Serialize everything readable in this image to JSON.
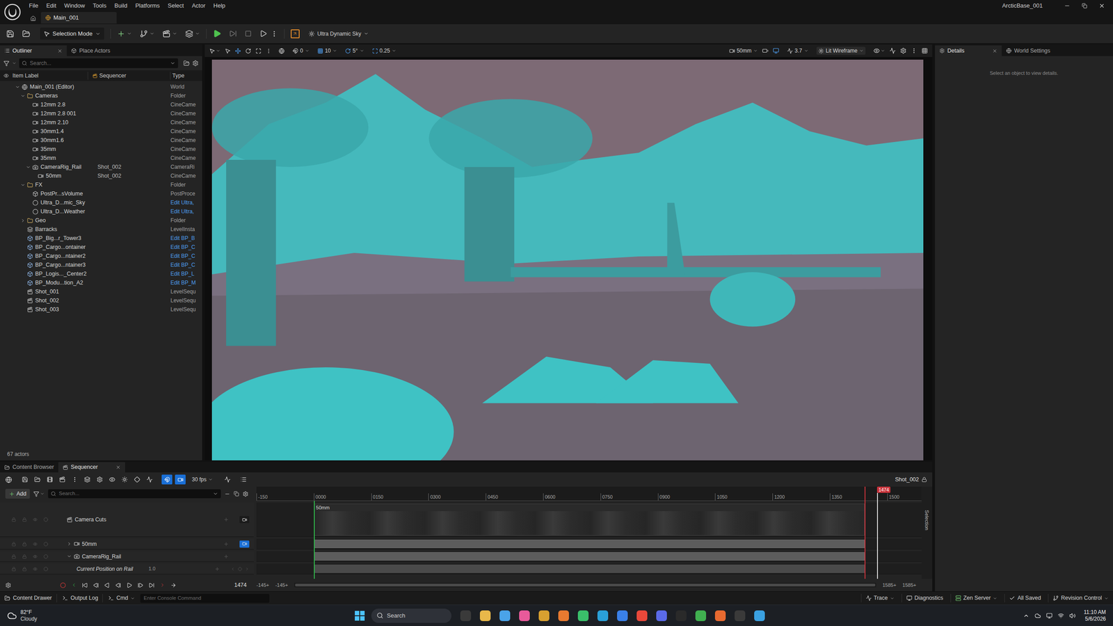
{
  "window": {
    "title": "ArcticBase_001",
    "menu": [
      "File",
      "Edit",
      "Window",
      "Tools",
      "Build",
      "Platforms",
      "Select",
      "Actor",
      "Help"
    ],
    "document_tab": "Main_001"
  },
  "toolbar": {
    "mode": "Selection Mode",
    "sky": "Ultra Dynamic Sky"
  },
  "outliner": {
    "tabs": [
      {
        "label": "Outliner",
        "selected": true
      },
      {
        "label": "Place Actors",
        "selected": false
      }
    ],
    "search_placeholder": "Search...",
    "columns": [
      "Item Label",
      "Sequencer",
      "Type"
    ],
    "rows": [
      {
        "label": "Main_001 (Editor)",
        "depth": 0,
        "kind": "world",
        "expandable": true,
        "expanded": true,
        "sequencer": "",
        "type": "World",
        "link": false
      },
      {
        "label": "Cameras",
        "depth": 1,
        "kind": "folder",
        "expandable": true,
        "expanded": true,
        "sequencer": "",
        "type": "Folder",
        "link": false
      },
      {
        "label": "12mm 2.8",
        "depth": 2,
        "kind": "camera",
        "expandable": false,
        "expanded": false,
        "sequencer": "",
        "type": "CineCame",
        "link": false
      },
      {
        "label": "12mm 2.8 001",
        "depth": 2,
        "kind": "camera",
        "expandable": false,
        "expanded": false,
        "sequencer": "",
        "type": "CineCame",
        "link": false
      },
      {
        "label": "12mm 2.10",
        "depth": 2,
        "kind": "camera",
        "expandable": false,
        "expanded": false,
        "sequencer": "",
        "type": "CineCame",
        "link": false
      },
      {
        "label": "30mm1.4",
        "depth": 2,
        "kind": "camera",
        "expandable": false,
        "expanded": false,
        "sequencer": "",
        "type": "CineCame",
        "link": false
      },
      {
        "label": "30mm1.6",
        "depth": 2,
        "kind": "camera",
        "expandable": false,
        "expanded": false,
        "sequencer": "",
        "type": "CineCame",
        "link": false
      },
      {
        "label": "35mm",
        "depth": 2,
        "kind": "camera",
        "expandable": false,
        "expanded": false,
        "sequencer": "",
        "type": "CineCame",
        "link": false
      },
      {
        "label": "35mm",
        "depth": 2,
        "kind": "camera",
        "expandable": false,
        "expanded": false,
        "sequencer": "",
        "type": "CineCame",
        "link": false
      },
      {
        "label": "CameraRig_Rail",
        "depth": 2,
        "kind": "rig",
        "expandable": true,
        "expanded": true,
        "sequencer": "Shot_002",
        "type": "CameraRi",
        "link": false
      },
      {
        "label": "50mm",
        "depth": 3,
        "kind": "camera",
        "expandable": false,
        "expanded": false,
        "sequencer": "Shot_002",
        "type": "CineCame",
        "link": false
      },
      {
        "label": "FX",
        "depth": 1,
        "kind": "folder",
        "expandable": true,
        "expanded": true,
        "sequencer": "",
        "type": "Folder",
        "link": false
      },
      {
        "label": "PostPr...sVolume",
        "depth": 2,
        "kind": "volume",
        "expandable": false,
        "expanded": false,
        "sequencer": "",
        "type": "PostProce",
        "link": false
      },
      {
        "label": "Ultra_D...mic_Sky",
        "depth": 2,
        "kind": "sky",
        "expandable": false,
        "expanded": false,
        "sequencer": "",
        "type": "Edit Ultra,",
        "link": true
      },
      {
        "label": "Ultra_D...Weather",
        "depth": 2,
        "kind": "sky",
        "expandable": false,
        "expanded": false,
        "sequencer": "",
        "type": "Edit Ultra,",
        "link": true
      },
      {
        "label": "Geo",
        "depth": 1,
        "kind": "folder",
        "expandable": true,
        "expanded": false,
        "sequencer": "",
        "type": "Folder",
        "link": false
      },
      {
        "label": "Barracks",
        "depth": 1,
        "kind": "level",
        "expandable": false,
        "expanded": false,
        "sequencer": "",
        "type": "LevelInsta",
        "link": false
      },
      {
        "label": "BP_Big...r_Tower3",
        "depth": 1,
        "kind": "blueprint",
        "expandable": false,
        "expanded": false,
        "sequencer": "",
        "type": "Edit BP_B",
        "link": true
      },
      {
        "label": "BP_Cargo...ontainer",
        "depth": 1,
        "kind": "blueprint",
        "expandable": false,
        "expanded": false,
        "sequencer": "",
        "type": "Edit BP_C",
        "link": true
      },
      {
        "label": "BP_Cargo...ntainer2",
        "depth": 1,
        "kind": "blueprint",
        "expandable": false,
        "expanded": false,
        "sequencer": "",
        "type": "Edit BP_C",
        "link": true
      },
      {
        "label": "BP_Cargo...ntainer3",
        "depth": 1,
        "kind": "blueprint",
        "expandable": false,
        "expanded": false,
        "sequencer": "",
        "type": "Edit BP_C",
        "link": true
      },
      {
        "label": "BP_Logis..._Center2",
        "depth": 1,
        "kind": "blueprint",
        "expandable": false,
        "expanded": false,
        "sequencer": "",
        "type": "Edit BP_L",
        "link": true
      },
      {
        "label": "BP_Modu...tion_A2",
        "depth": 1,
        "kind": "blueprint",
        "expandable": false,
        "expanded": false,
        "sequencer": "",
        "type": "Edit BP_M",
        "link": true
      },
      {
        "label": "Shot_001",
        "depth": 1,
        "kind": "sequence",
        "expandable": false,
        "expanded": false,
        "sequencer": "",
        "type": "LevelSequ",
        "link": false
      },
      {
        "label": "Shot_002",
        "depth": 1,
        "kind": "sequence",
        "expandable": false,
        "expanded": false,
        "sequencer": "",
        "type": "LevelSequ",
        "link": false
      },
      {
        "label": "Shot_003",
        "depth": 1,
        "kind": "sequence",
        "expandable": false,
        "expanded": false,
        "sequencer": "",
        "type": "LevelSequ",
        "link": false
      }
    ],
    "footer": "67 actors"
  },
  "viewport": {
    "snaps": [
      "0",
      "10",
      "5°",
      "0.25"
    ],
    "camera": "50mm",
    "speed": "3.7",
    "view_mode": "Lit Wireframe"
  },
  "details": {
    "tabs": [
      {
        "label": "Details",
        "selected": true
      },
      {
        "label": "World Settings",
        "selected": false
      }
    ],
    "empty": "Select an object to view details."
  },
  "bottom_tabs": [
    {
      "label": "Content Browser",
      "selected": false
    },
    {
      "label": "Sequencer",
      "selected": true
    }
  ],
  "sequencer": {
    "fps": "30 fps",
    "sequence": "Shot_002",
    "add": "Add",
    "search_placeholder": "Search...",
    "side_tab": "Selection",
    "ticks": [
      "-150",
      "0000",
      "0150",
      "0300",
      "0450",
      "0600",
      "0750",
      "0900",
      "1050",
      "1200",
      "1350",
      "1500"
    ],
    "playhead": "1474",
    "playback_range": {
      "start": 0,
      "end": 1441
    },
    "tracks": [
      {
        "name": "Camera Cuts",
        "kind": "cuts",
        "depth": 0,
        "expandable": false,
        "expanded": false,
        "clip": "50mm"
      },
      {
        "name": "50mm",
        "kind": "camera",
        "depth": 0,
        "expandable": true,
        "expanded": false
      },
      {
        "name": "CameraRig_Rail",
        "kind": "rig",
        "depth": 0,
        "expandable": true,
        "expanded": true
      },
      {
        "name": "Current Position on Rail",
        "kind": "property",
        "depth": 1,
        "value": "1.0"
      }
    ],
    "current_frame": "1474",
    "view_start": [
      "-145+",
      "-145+"
    ],
    "view_end": [
      "1585+",
      "1585+"
    ]
  },
  "status_bar": {
    "left": [
      "Content Drawer",
      "Output Log"
    ],
    "cmd": "Cmd",
    "console_placeholder": "Enter Console Command",
    "right": [
      "Trace",
      "Diagnostics",
      "Zen Server",
      "All Saved",
      "Revision Control"
    ]
  },
  "taskbar": {
    "temperature": "82°F",
    "weather": "Cloudy",
    "search": "Search",
    "time": "11:10 AM",
    "date": "5/6/2026"
  }
}
